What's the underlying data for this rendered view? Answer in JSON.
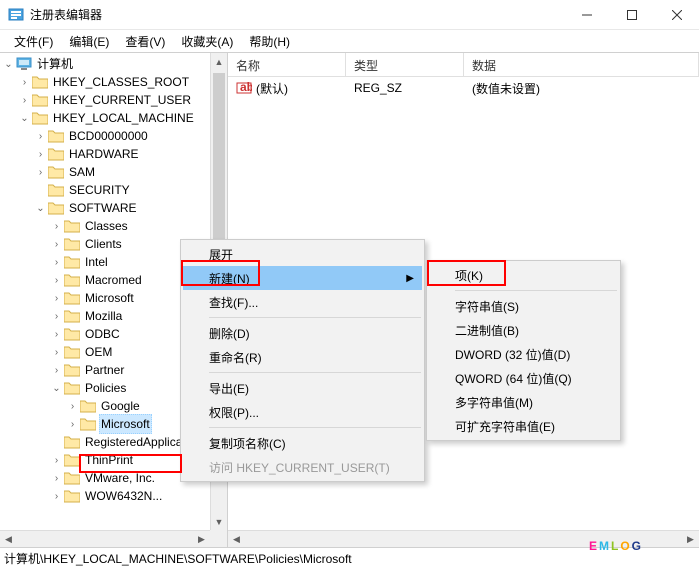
{
  "window": {
    "title": "注册表编辑器"
  },
  "menubar": {
    "file": "文件(F)",
    "edit": "编辑(E)",
    "view": "查看(V)",
    "favorites": "收藏夹(A)",
    "help": "帮助(H)"
  },
  "tree": {
    "root": "计算机",
    "hkcr": "HKEY_CLASSES_ROOT",
    "hkcu": "HKEY_CURRENT_USER",
    "hklm": "HKEY_LOCAL_MACHINE",
    "bcd": "BCD00000000",
    "hardware": "HARDWARE",
    "sam": "SAM",
    "security": "SECURITY",
    "software": "SOFTWARE",
    "classes": "Classes",
    "clients": "Clients",
    "intel": "Intel",
    "macromed": "Macromed",
    "microsoft": "Microsoft",
    "mozilla": "Mozilla",
    "odbc": "ODBC",
    "oem": "OEM",
    "partner": "Partner",
    "policies": "Policies",
    "google": "Google",
    "microsoft2": "Microsoft",
    "registeredapps": "RegisteredApplica",
    "thinprint": "ThinPrint",
    "vmware": "VMware, Inc.",
    "wow": "WOW6432N..."
  },
  "list": {
    "cols": {
      "name": "名称",
      "type": "类型",
      "data": "数据"
    },
    "rows": [
      {
        "name": "(默认)",
        "type": "REG_SZ",
        "data": "(数值未设置)"
      }
    ]
  },
  "ctx1": {
    "expand": "展开",
    "new": "新建(N)",
    "find": "查找(F)...",
    "delete": "删除(D)",
    "rename": "重命名(R)",
    "export": "导出(E)",
    "permissions": "权限(P)...",
    "copykeyname": "复制项名称(C)",
    "goto_hkcu": "访问 HKEY_CURRENT_USER(T)"
  },
  "ctx2": {
    "key": "项(K)",
    "string": "字符串值(S)",
    "binary": "二进制值(B)",
    "dword": "DWORD (32 位)值(D)",
    "qword": "QWORD (64 位)值(Q)",
    "multistr": "多字符串值(M)",
    "expandstr": "可扩充字符串值(E)"
  },
  "statusbar": {
    "path": "计算机\\HKEY_LOCAL_MACHINE\\SOFTWARE\\Policies\\Microsoft"
  },
  "watermark": "EMLOG"
}
